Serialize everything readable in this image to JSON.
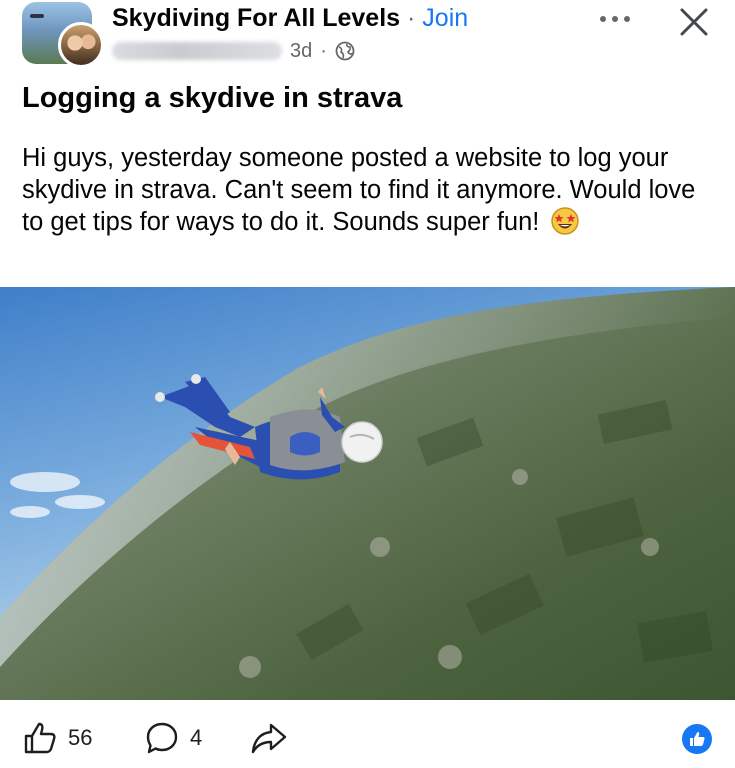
{
  "header": {
    "group_name": "Skydiving For All Levels",
    "separator": "·",
    "join_label": "Join",
    "timestamp": "3d",
    "time_separator": "·"
  },
  "post": {
    "title": "Logging a skydive in strava",
    "body": "Hi guys, yesterday someone posted a website to log your skydive in strava. Can't seem to find it anymore. Would love to get tips for ways to do it. Sounds super fun!",
    "emoji": "star-struck-emoji"
  },
  "actions": {
    "like_count": "56",
    "comment_count": "4"
  },
  "colors": {
    "link_blue": "#1877f2",
    "secondary_text": "#65676b",
    "primary_text": "#050505"
  },
  "icons": [
    "more-dots-icon",
    "close-icon",
    "globe-icon",
    "like-icon",
    "comment-icon",
    "share-icon",
    "like-reaction-icon"
  ]
}
